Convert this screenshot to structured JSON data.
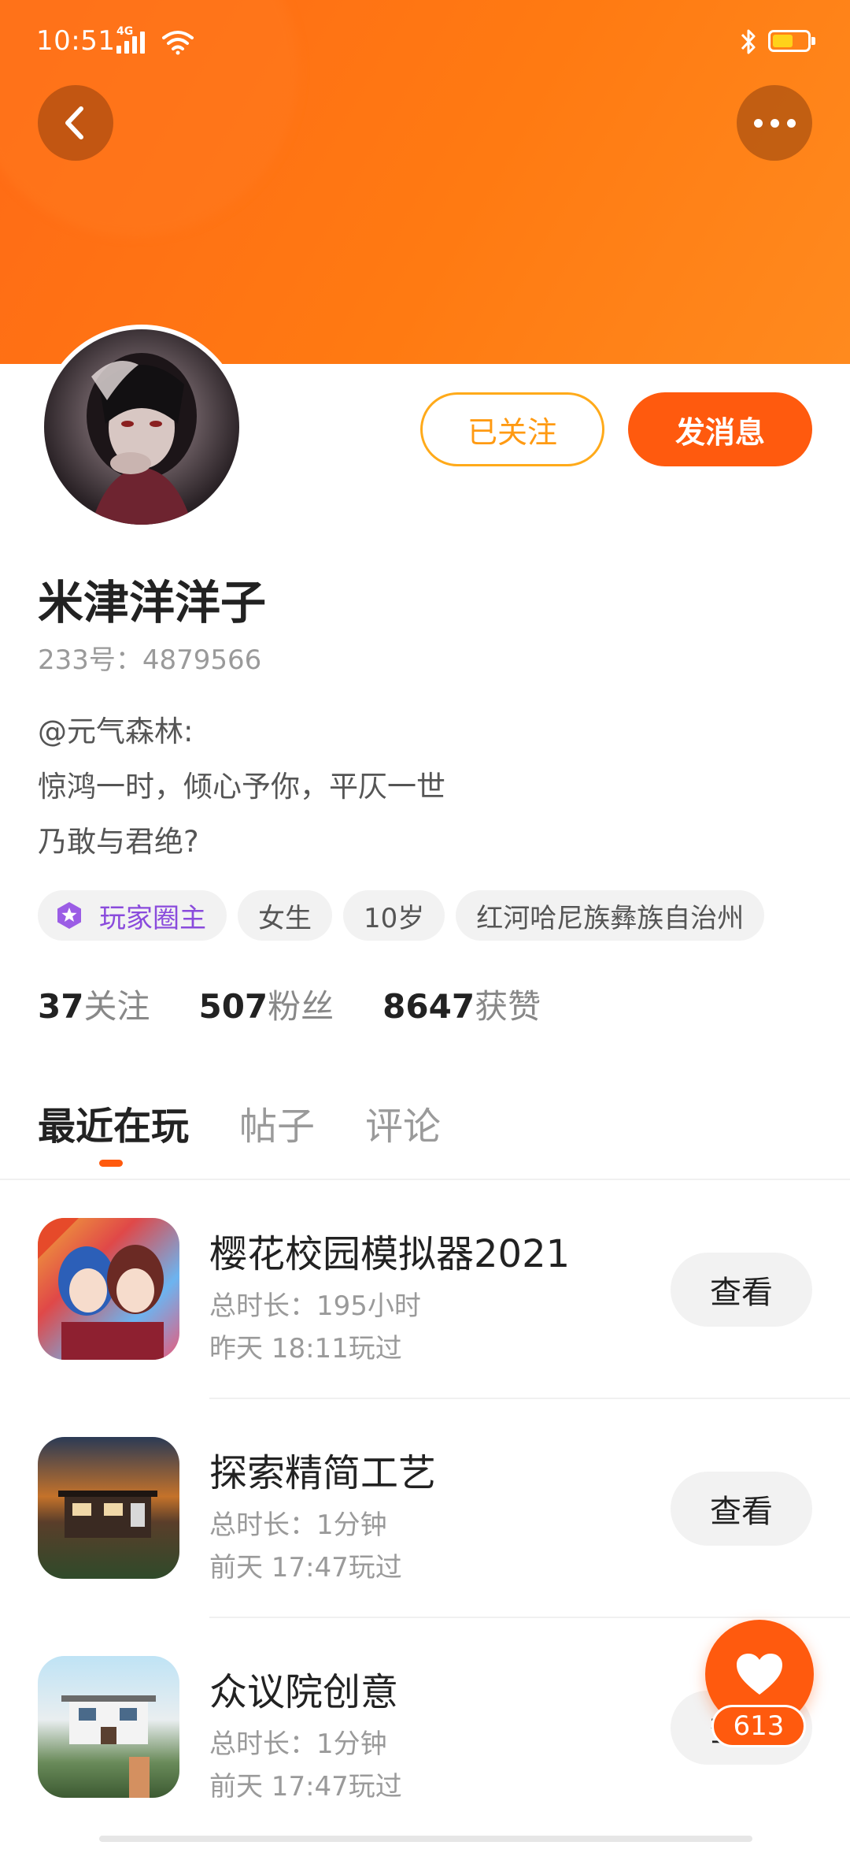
{
  "status_bar": {
    "time": "10:51",
    "network": "4G",
    "battery_level": 0.6,
    "battery_color": "#ffd21a"
  },
  "header": {
    "back_icon": "chevron-left-icon",
    "more_icon": "more-horizontal-icon",
    "gradient_color": "#ff6a16"
  },
  "profile": {
    "name": "米津洋洋子",
    "id_text": "233号：4879566",
    "follow_label": "已关注",
    "message_label": "发消息",
    "bio": [
      "@元气森林:",
      "惊鸿一时，倾心予你，平仄一世",
      "乃敢与君绝?"
    ],
    "tags": [
      {
        "label": "玩家圈主",
        "icon": "star-badge-icon"
      },
      {
        "label": "女生"
      },
      {
        "label": "10岁"
      },
      {
        "label": "红河哈尼族彝族自治州"
      }
    ],
    "stats": {
      "following_num": "37",
      "following_label": "关注",
      "fans_num": "507",
      "fans_label": "粉丝",
      "likes_num": "8647",
      "likes_label": "获赞"
    }
  },
  "tabs": [
    {
      "label": "最近在玩",
      "active": true
    },
    {
      "label": "帖子",
      "active": false
    },
    {
      "label": "评论",
      "active": false
    }
  ],
  "games": [
    {
      "title": "樱花校园模拟器2021",
      "duration": "总时长：195小时",
      "last_played": "昨天 18:11玩过",
      "button": "查看"
    },
    {
      "title": "探索精简工艺",
      "duration": "总时长：1分钟",
      "last_played": "前天 17:47玩过",
      "button": "查看"
    },
    {
      "title": "众议院创意",
      "duration": "总时长：1分钟",
      "last_played": "前天 17:47玩过",
      "button": "查看"
    }
  ],
  "like_fab": {
    "count": "613",
    "icon": "heart-icon"
  },
  "colors": {
    "accent": "#ff5a0e",
    "follow_border": "#ffaa1a",
    "badge_purple": "#8a4bdc"
  }
}
